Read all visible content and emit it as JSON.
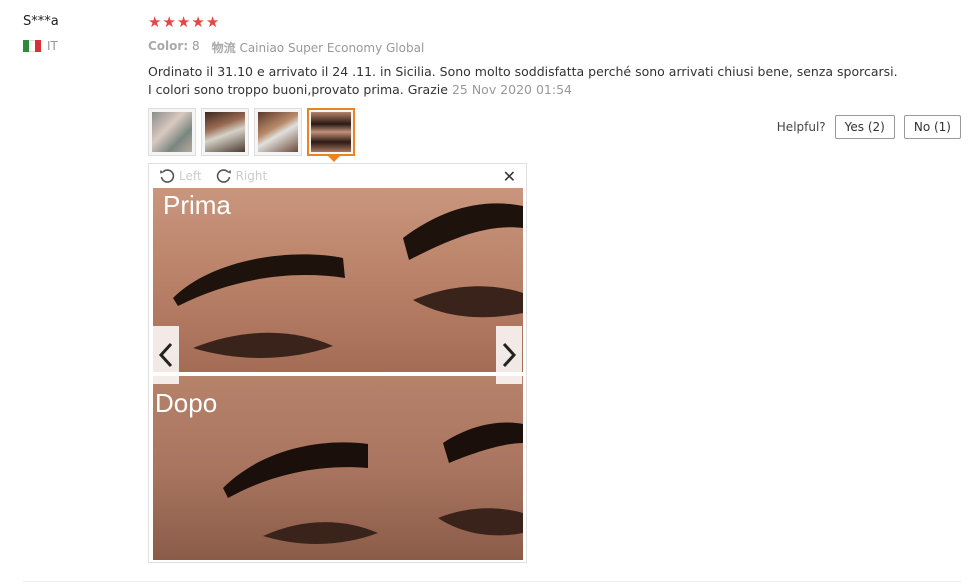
{
  "review": {
    "user_name": "S***a",
    "country": "IT",
    "flag_colors": [
      "#2e8b3a",
      "#ffffff",
      "#d9313a"
    ],
    "rating": 5,
    "star_color": "#e64545",
    "color_label": "Color:",
    "color_value": "8",
    "logistics_label": "物流",
    "logistics_value": "Cainiao Super Economy Global",
    "text_line1": "Ordinato il 31.10 e arrivato il 24 .11. in Sicilia. Sono molto soddisfatta perché sono arrivati chiusi bene, senza sporcarsi.",
    "text_line2": "I colori sono troppo buoni,provato prima. Grazie",
    "date": "25 Nov 2020 01:54"
  },
  "thumbnails": [
    {
      "name": "thumb-1",
      "active": false
    },
    {
      "name": "thumb-2",
      "active": false
    },
    {
      "name": "thumb-3",
      "active": false
    },
    {
      "name": "thumb-4",
      "active": true
    }
  ],
  "helpful": {
    "label": "Helpful?",
    "yes_label": "Yes (2)",
    "no_label": "No (1)"
  },
  "viewer": {
    "rotate_left_label": "Left",
    "rotate_right_label": "Right",
    "close_icon": "close-icon",
    "photo_top_caption": "Prima",
    "photo_bottom_caption": "Dopo"
  }
}
